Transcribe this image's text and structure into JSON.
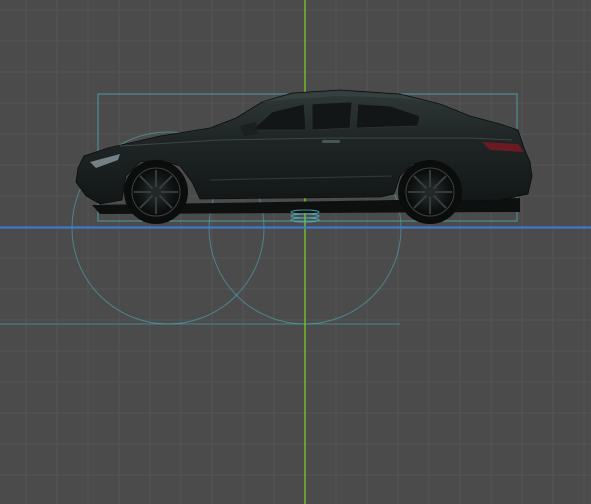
{
  "viewport": {
    "view_label": "",
    "view": "side-orthographic"
  },
  "colors": {
    "background": "#4b4b4b",
    "grid_minor": "#545454",
    "grid_major": "#5a5a5a",
    "axis_vertical": "#7ecb1e",
    "axis_horizontal": "#3d7be0",
    "helper_cyan": "#4fb3bf",
    "car_body": "#1c2121",
    "car_body_highlight": "#2c3434",
    "car_glass": "#151a1b",
    "tail_light": "#6a1b22"
  },
  "scene": {
    "object": "black-coupe-model",
    "icons": [
      "selection-bounding-box",
      "wheel-guide-circle",
      "ground-plane-line",
      "vertical-axis-line"
    ]
  }
}
